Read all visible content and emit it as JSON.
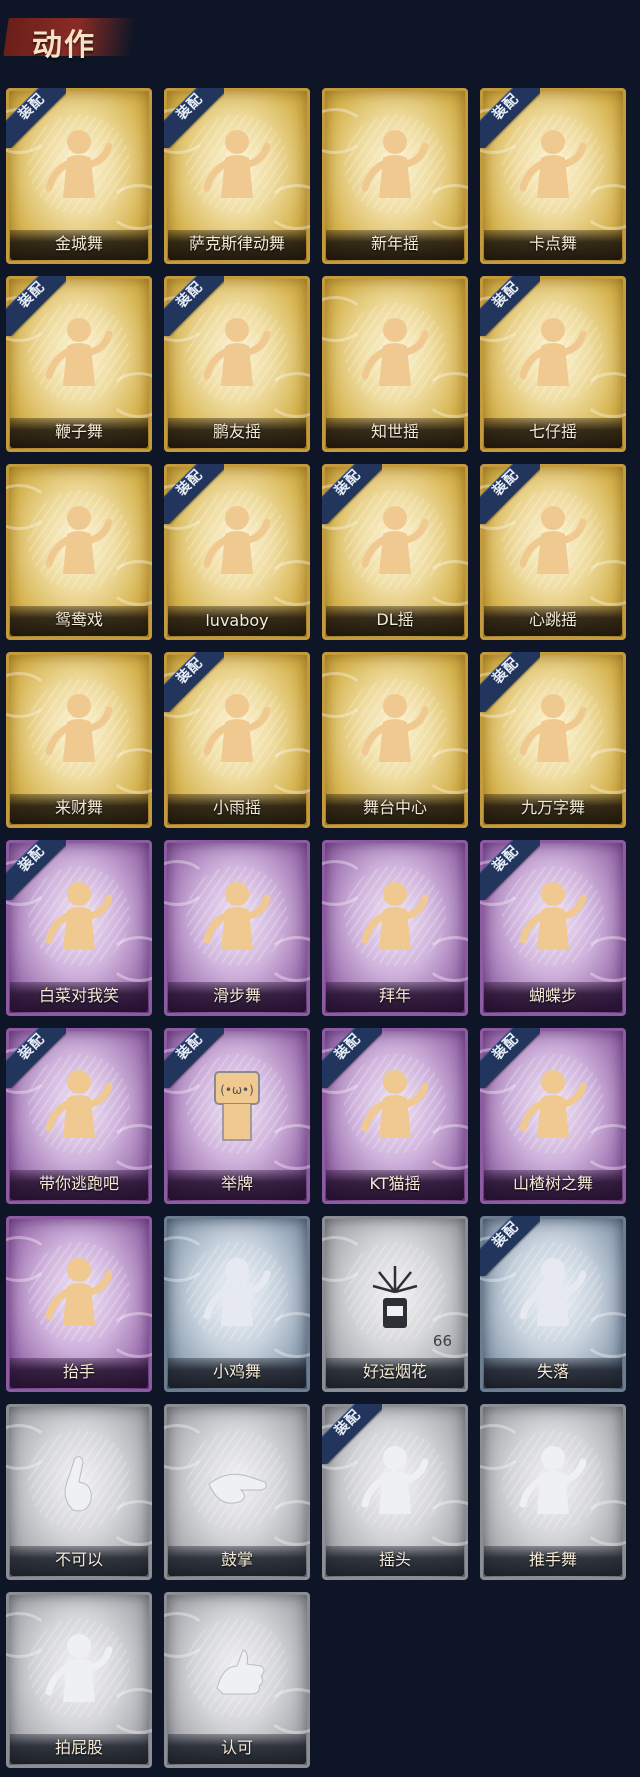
{
  "header": {
    "title": "动作"
  },
  "equip_label": "装配",
  "tiers": {
    "gold": {
      "accent": "#c39a3c"
    },
    "purple": {
      "accent": "#8e5aa2"
    },
    "blue": {
      "accent": "#6c7d90"
    },
    "grey": {
      "accent": "#8c8e94"
    }
  },
  "actions": [
    {
      "name": "金城舞",
      "tier": "gold",
      "equipped": true,
      "icon": "dancer-pose-icon"
    },
    {
      "name": "萨克斯律动舞",
      "tier": "gold",
      "equipped": true,
      "icon": "sunglasses-dancer-icon"
    },
    {
      "name": "新年摇",
      "tier": "gold",
      "equipped": false,
      "icon": "dancer-pose-icon"
    },
    {
      "name": "卡点舞",
      "tier": "gold",
      "equipped": true,
      "icon": "dancer-arm-up-icon"
    },
    {
      "name": "鞭子舞",
      "tier": "gold",
      "equipped": true,
      "icon": "dancer-pose-icon"
    },
    {
      "name": "鹏友摇",
      "tier": "gold",
      "equipped": true,
      "icon": "dancer-pose-icon"
    },
    {
      "name": "知世摇",
      "tier": "gold",
      "equipped": false,
      "icon": "dancer-pose-icon"
    },
    {
      "name": "七仔摇",
      "tier": "gold",
      "equipped": true,
      "icon": "dancer-pose-icon"
    },
    {
      "name": "鸳鸯戏",
      "tier": "gold",
      "equipped": false,
      "icon": "dancer-pose-icon"
    },
    {
      "name": "luvaboy",
      "tier": "gold",
      "equipped": true,
      "icon": "dancer-pose-icon"
    },
    {
      "name": "DL摇",
      "tier": "gold",
      "equipped": true,
      "icon": "dancer-arm-up-icon"
    },
    {
      "name": "心跳摇",
      "tier": "gold",
      "equipped": true,
      "icon": "dancer-pose-icon"
    },
    {
      "name": "来财舞",
      "tier": "gold",
      "equipped": false,
      "icon": "dancer-pose-icon"
    },
    {
      "name": "小雨摇",
      "tier": "gold",
      "equipped": true,
      "icon": "dancer-pose-icon"
    },
    {
      "name": "舞台中心",
      "tier": "gold",
      "equipped": false,
      "icon": "dancer-pose-icon"
    },
    {
      "name": "九万字舞",
      "tier": "gold",
      "equipped": true,
      "icon": "dancer-pose-icon"
    },
    {
      "name": "白菜对我笑",
      "tier": "purple",
      "equipped": true,
      "icon": "dancer-pose-icon"
    },
    {
      "name": "滑步舞",
      "tier": "purple",
      "equipped": false,
      "icon": "dancer-pose-icon"
    },
    {
      "name": "拜年",
      "tier": "purple",
      "equipped": false,
      "icon": "bow-greeting-icon"
    },
    {
      "name": "蝴蝶步",
      "tier": "purple",
      "equipped": true,
      "icon": "dancer-pose-icon"
    },
    {
      "name": "带你逃跑吧",
      "tier": "purple",
      "equipped": true,
      "icon": "dancer-pose-icon"
    },
    {
      "name": "举牌",
      "tier": "purple",
      "equipped": true,
      "icon": "hold-sign-icon"
    },
    {
      "name": "KT猫摇",
      "tier": "purple",
      "equipped": true,
      "icon": "dancer-pose-icon"
    },
    {
      "name": "山楂树之舞",
      "tier": "purple",
      "equipped": true,
      "icon": "dancer-arm-up-icon"
    },
    {
      "name": "抬手",
      "tier": "purple",
      "equipped": false,
      "icon": "raise-hand-icon"
    },
    {
      "name": "小鸡舞",
      "tier": "blue",
      "equipped": false,
      "icon": "chicken-dance-icon"
    },
    {
      "name": "好运烟花",
      "tier": "grey",
      "equipped": false,
      "icon": "firework-icon",
      "count": "66"
    },
    {
      "name": "失落",
      "tier": "blue",
      "equipped": true,
      "icon": "crawl-sad-icon"
    },
    {
      "name": "不可以",
      "tier": "grey",
      "equipped": false,
      "icon": "finger-wag-icon"
    },
    {
      "name": "鼓掌",
      "tier": "grey",
      "equipped": false,
      "icon": "clap-icon"
    },
    {
      "name": "摇头",
      "tier": "grey",
      "equipped": true,
      "icon": "head-shake-icon"
    },
    {
      "name": "推手舞",
      "tier": "grey",
      "equipped": false,
      "icon": "push-hand-icon"
    },
    {
      "name": "拍屁股",
      "tier": "grey",
      "equipped": false,
      "icon": "butt-slap-icon"
    },
    {
      "name": "认可",
      "tier": "grey",
      "equipped": false,
      "icon": "thumbs-up-icon"
    }
  ]
}
